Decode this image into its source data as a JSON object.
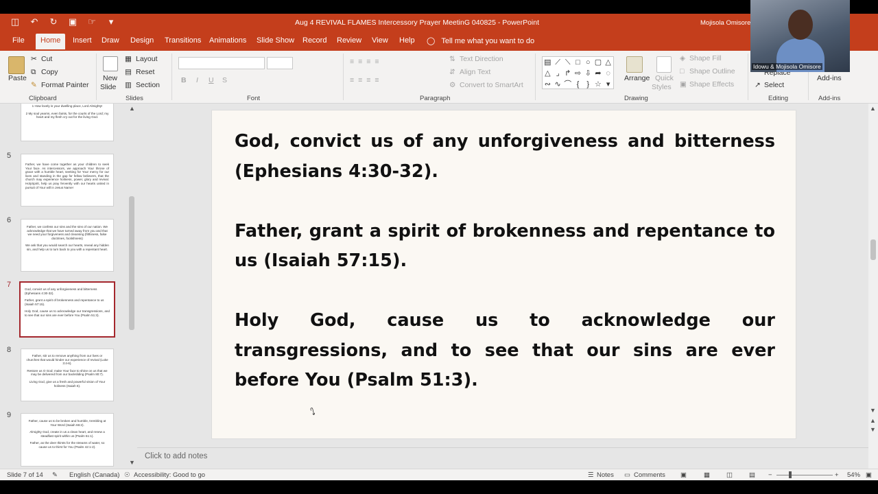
{
  "window": {
    "title": "Aug 4 REVIVAL FLAMES Intercessory Prayer MeetinG 040825  -  PowerPoint",
    "account_name": "Mojisola Omisore"
  },
  "tabs": [
    "File",
    "Home",
    "Insert",
    "Draw",
    "Design",
    "Transitions",
    "Animations",
    "Slide Show",
    "Record",
    "Review",
    "View",
    "Help"
  ],
  "tell_me": "Tell me what you want to do",
  "ribbon": {
    "clipboard": {
      "paste": "Paste",
      "cut": "Cut",
      "copy": "Copy",
      "format_painter": "Format Painter",
      "label": "Clipboard"
    },
    "slides": {
      "new_slide_1": "New",
      "new_slide_2": "Slide",
      "layout": "Layout",
      "reset": "Reset",
      "section": "Section",
      "label": "Slides"
    },
    "font": {
      "label": "Font"
    },
    "paragraph": {
      "text_direction": "Text Direction",
      "align_text": "Align Text",
      "convert_smartart": "Convert to SmartArt",
      "label": "Paragraph"
    },
    "drawing": {
      "arrange": "Arrange",
      "quick_styles_1": "Quick",
      "quick_styles_2": "Styles",
      "shape_fill": "Shape Fill",
      "shape_outline": "Shape Outline",
      "shape_effects": "Shape Effects",
      "label": "Drawing"
    },
    "editing": {
      "replace": "Replace",
      "select": "Select",
      "label": "Editing"
    },
    "addins": {
      "addins": "Add-ins",
      "label": "Add-ins"
    }
  },
  "thumbnails": [
    {
      "num": "",
      "lines": [
        "1 How lovely is your dwelling place, Lord Almighty!",
        "",
        "2 My soul yearns, even faints, for the courts of the Lord; my heart and my flesh cry out for the living God."
      ]
    },
    {
      "num": "5",
      "lines": [
        "Father, we have come together as your children to seek Your face. As intercessors, we approach Your throne of grace with a humble heart, seeking for Your mercy for our lives and standing in the gap for fellow believers, that the church may experience holiness, power, glory and revival. HolySpirit, help us pray fervently with our hearts united in pursuit of Your will in Jesus Name!"
      ]
    },
    {
      "num": "6",
      "lines": [
        "Father, we confess our sins and the sins of our nation. We acknowledge that we have turned away from you and that we need your forgiveness and cleansing (filthiness, false doctrines, foolishness)",
        "",
        "We ask that you would search our hearts, reveal any hidden sin, and help us to turn back to you with a repentant heart."
      ]
    },
    {
      "num": "7",
      "lines": [
        "God, convict us of any unforgiveness and bitterness (Ephesians 4:30-32).",
        "",
        "Father, grant a spirit of brokenness and repentance to us (Isaiah 57:15).",
        "",
        "Holy God, cause us to acknowledge our transgressions, and to see that our sins are ever before You (Psalm 51:3)."
      ]
    },
    {
      "num": "8",
      "lines": [
        "Father, stir us to remove anything from our lives or churches that would hinder our experience of revival (Luke 3:4-6).",
        "",
        "Restore us O God; make Your face to shine on us that we may be delivered from our backsliding (Psalm 80:7).",
        "",
        "Living God, give us a fresh and powerful vision of Your holiness (Isaiah 6)."
      ]
    },
    {
      "num": "9",
      "lines": [
        "Father, cause us to be broken and humble, trembling at Your Word (Isaiah 66:2).",
        "",
        "Almighty God, create in us a clean heart, and renew a steadfast spirit within us (Psalm 51:1).",
        "",
        "Father, as the deer thirsts for the streams of water, so cause us to thirst for You (Psalm 42:1-2)."
      ]
    }
  ],
  "slide": {
    "paragraphs": [
      "God, convict us of any unforgiveness and bitterness (Ephesians 4:30-32).",
      "Father, grant a spirit of brokenness and repentance to us (Isaiah 57:15).",
      "Holy God, cause us to acknowledge our transgressions, and to see that our sins are ever before You (Psalm 51:3)."
    ]
  },
  "notes_placeholder": "Click to add notes",
  "status": {
    "slide_count": "Slide 7 of 14",
    "language": "English (Canada)",
    "accessibility": "Accessibility: Good to go",
    "notes": "Notes",
    "comments": "Comments",
    "zoom": "54%"
  },
  "video": {
    "participant": "Idowu & Mojisola Omisore"
  },
  "colors": {
    "accent": "#c43e1c",
    "selected_thumb": "#a4262c"
  }
}
